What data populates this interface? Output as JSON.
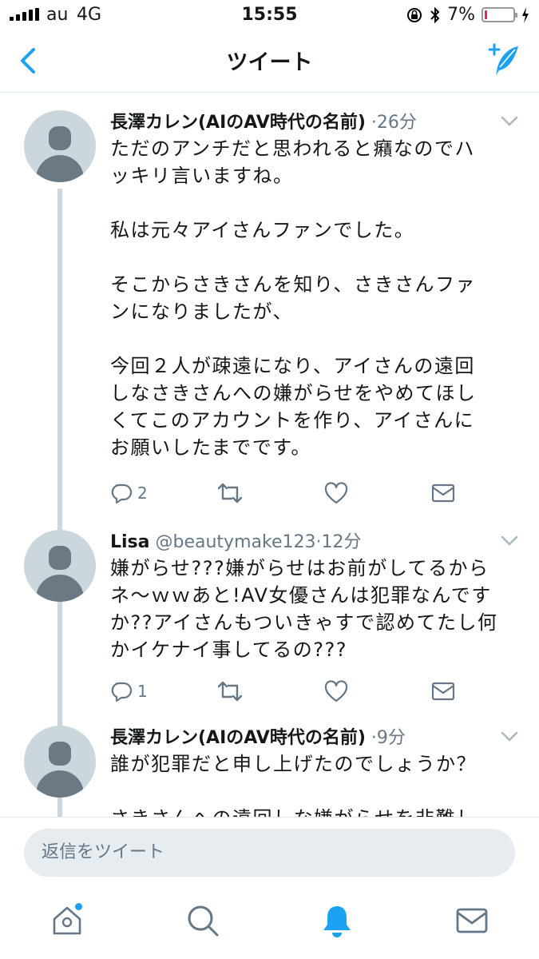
{
  "status_bar": {
    "carrier": "au",
    "network": "4G",
    "time": "15:55",
    "battery_percent": "7%",
    "battery_level": 0.07
  },
  "nav": {
    "title": "ツイート",
    "accent_color": "#1da1f2"
  },
  "tweets": [
    {
      "name": "長澤カレン(AIのAV時代の名前)",
      "handle": "",
      "time": "26分",
      "text": "ただのアンチだと思われると癪なのでハ\nッキリ言いますね。\n\n私は元々アイさんファンでした。\n\nそこからさきさんを知り、さきさんファ\nンになりましたが、\n\n今回２人が疎遠になり、アイさんの遠回\nしなさきさんへの嫌がらせをやめてほし\nくてこのアカウントを作り、アイさんに\nお願いしたまでです。",
      "reply_count": "2"
    },
    {
      "name": "Lisa",
      "handle": "@beautymake123",
      "time": "12分",
      "text": "嫌がらせ???嫌がらせはお前がしてるから\nネ〜ｗｗあと!AV女優さんは犯罪なんです\nか??アイさんもついきゃすで認めてたし何\nかイケナイ事してるの???",
      "reply_count": "1"
    },
    {
      "name": "長澤カレン(AIのAV時代の名前)",
      "handle": "",
      "time": "9分",
      "text": "誰が犯罪だと申し上げたのでしょうか？\n\nさきさんへの遠回しな嫌がらせを非難し",
      "reply_count": ""
    }
  ],
  "reply": {
    "placeholder": "返信をツイート"
  },
  "tabs": [
    "home-icon",
    "search-icon",
    "notifications-icon",
    "messages-icon"
  ]
}
